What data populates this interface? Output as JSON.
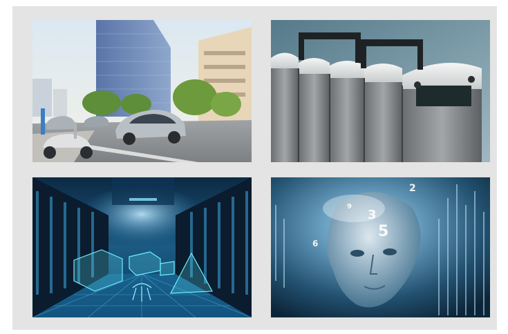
{
  "colors": {
    "panel_background": "#e3e4e3",
    "page_background": "#ffffff"
  },
  "tiles": [
    {
      "icon": "electric-mobility-city-scene"
    },
    {
      "icon": "battery-cells-closeup"
    },
    {
      "icon": "data-center-server-room"
    },
    {
      "icon": "artificial-intelligence-head"
    }
  ]
}
